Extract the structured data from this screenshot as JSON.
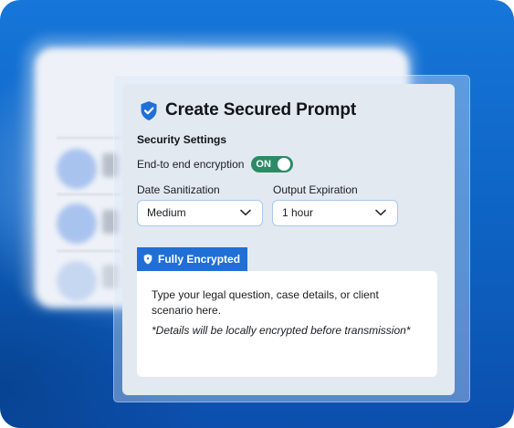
{
  "card": {
    "title": "Create Secured Prompt",
    "title_icon": "shield-check-icon"
  },
  "security": {
    "heading": "Security Settings",
    "encryption_label": "End-to end encryption",
    "encryption_toggle": "ON",
    "encryption_enabled": true
  },
  "fields": {
    "sanitization_label": "Date Sanitization",
    "sanitization_value": "Medium",
    "expiration_label": "Output Expiration",
    "expiration_value": "1 hour"
  },
  "badge": {
    "label": "Fully Encrypted",
    "icon": "shield-icon"
  },
  "prompt": {
    "placeholder": "Type your legal question, case details, or client scenario here.",
    "note": "*Details will be locally encrypted before transmission*"
  },
  "colors": {
    "accent_blue": "#1f6fd6",
    "toggle_green": "#2c8a66",
    "background_blue": "#1676d9",
    "card_bg": "#e3e9f1"
  }
}
